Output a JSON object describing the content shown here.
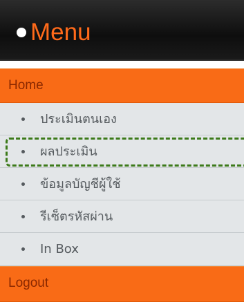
{
  "header": {
    "title": "Menu",
    "dot_icon": "circle-bullet-icon"
  },
  "nav": {
    "home_label": "Home",
    "logout_label": "Logout"
  },
  "submenu": {
    "items": [
      {
        "label": "ประเมินตนเอง"
      },
      {
        "label": "ผลประเมิน"
      },
      {
        "label": "ข้อมูลบัญชีผู้ใช้"
      },
      {
        "label": "รีเซ็ตรหัสผ่าน"
      },
      {
        "label": "In Box"
      }
    ]
  },
  "highlight": {
    "item_index": 1
  },
  "colors": {
    "header_bg": "#111111",
    "accent_orange": "#f96b16",
    "title_orange": "#ff6a1a",
    "submenu_bg": "#e3e6e8",
    "highlight_green": "#3c7a1a"
  }
}
